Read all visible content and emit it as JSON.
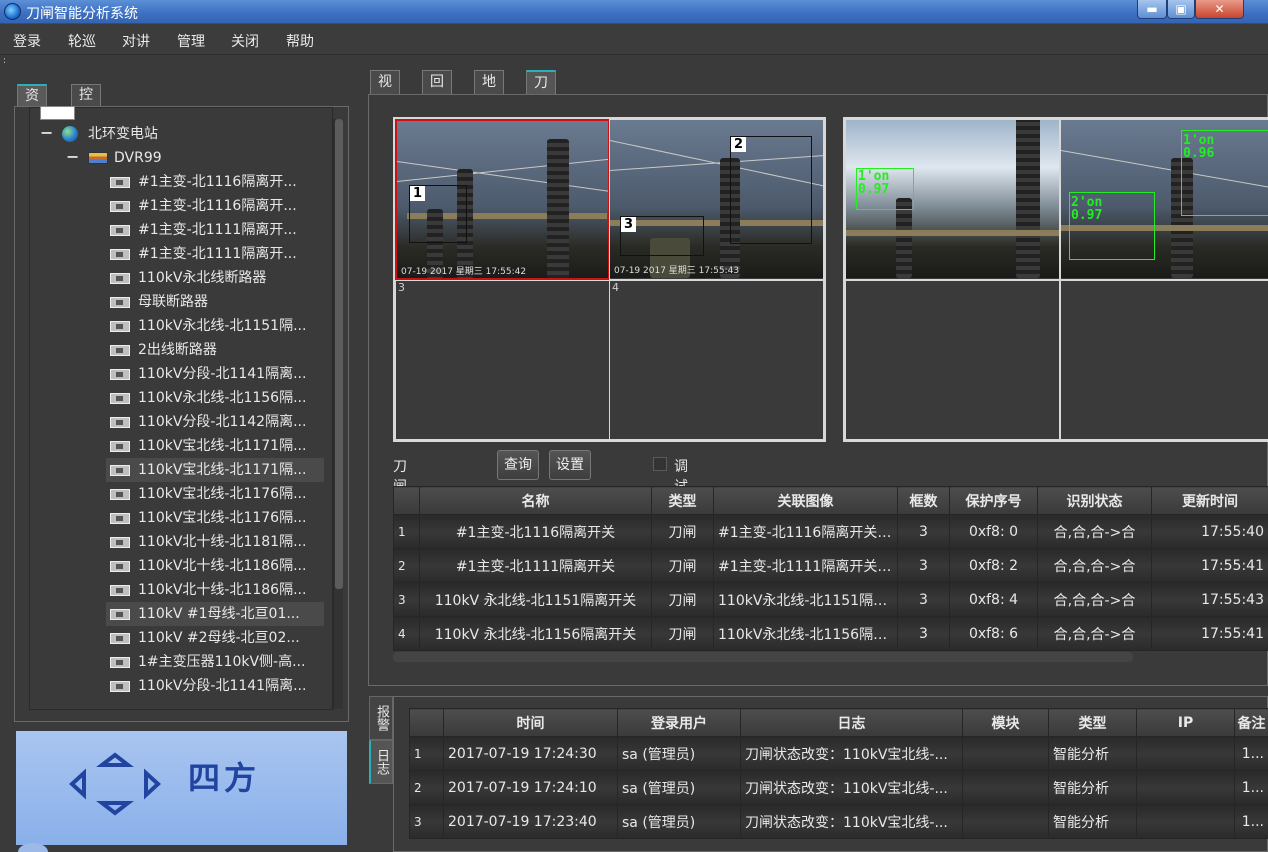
{
  "window": {
    "title": "刀闸智能分析系统",
    "min_label": "▬",
    "max_label": "▣",
    "close_label": "✕"
  },
  "menu": [
    "登录",
    "轮巡",
    "对讲",
    "管理",
    "关闭",
    "帮助"
  ],
  "left_tabs": [
    "资源",
    "控制"
  ],
  "tree": {
    "root": "北环变电站",
    "dvr": "DVR99",
    "items": [
      "#1主变-北1116隔离开...",
      "#1主变-北1116隔离开...",
      "#1主变-北1111隔离开...",
      "#1主变-北1111隔离开...",
      "110kV永北线断路器",
      "母联断路器",
      "110kV永北线-北1151隔...",
      "2出线断路器",
      "110kV分段-北1141隔离...",
      "110kV永北线-北1156隔...",
      "110kV分段-北1142隔离...",
      "110kV宝北线-北1171隔...",
      "110kV宝北线-北1171隔...",
      "110kV宝北线-北1176隔...",
      "110kV宝北线-北1176隔...",
      "110kV北十线-北1181隔...",
      "110kV北十线-北1186隔...",
      "110kV北十线-北1186隔...",
      "110kV #1母线-北亘01...",
      "110kV #2母线-北亘02...",
      "1#主变压器110kV侧-高...",
      "110kV分段-北1141隔离..."
    ]
  },
  "logo_text": "四方",
  "right_tabs": [
    "视频",
    "回放",
    "地图",
    "刀闸"
  ],
  "video": {
    "left_cell_numbers": [
      "3",
      "4"
    ],
    "box_labels": [
      "1",
      "2",
      "3"
    ],
    "left_timestamp": "07-19 2017 星期三 17:55:42",
    "right_timestamp": "07-19 2017 星期三 17:55:43",
    "right_cam1_label": "1'on\n0.97",
    "right_cam2_label_a": "1'on\n0.96",
    "right_cam2_label_b": "2'on\n0.97"
  },
  "toolbar": {
    "section_label": "刀闸",
    "query_btn": "查询",
    "settings_btn": "设置",
    "debug_mode": "调试模式"
  },
  "knife_table": {
    "headers": [
      "",
      "名称",
      "类型",
      "关联图像",
      "框数",
      "保护序号",
      "识别状态",
      "更新时间"
    ],
    "rows": [
      [
        "1",
        "#1主变-北1116隔离开关",
        "刀闸",
        "#1主变-北1116隔离开关…",
        "3",
        "0xf8: 0",
        "合,合,合->合",
        "17:55:40"
      ],
      [
        "2",
        "#1主变-北1111隔离开关",
        "刀闸",
        "#1主变-北1111隔离开关…",
        "3",
        "0xf8: 2",
        "合,合,合->合",
        "17:55:41"
      ],
      [
        "3",
        "110kV 永北线-北1151隔离开关",
        "刀闸",
        "110kV永北线-北1151隔…",
        "3",
        "0xf8: 4",
        "合,合,合->合",
        "17:55:43"
      ],
      [
        "4",
        "110kV 永北线-北1156隔离开关",
        "刀闸",
        "110kV永北线-北1156隔…",
        "3",
        "0xf8: 6",
        "合,合,合->合",
        "17:55:41"
      ]
    ]
  },
  "side_tabs": [
    "报警",
    "日志"
  ],
  "log_table": {
    "headers": [
      "",
      "时间",
      "登录用户",
      "日志",
      "模块",
      "类型",
      "IP",
      "备注"
    ],
    "rows": [
      [
        "1",
        "2017-07-19 17:24:30",
        "sa (管理员)",
        "刀闸状态改变：110kV宝北线-...",
        "",
        "智能分析",
        "",
        "1..."
      ],
      [
        "2",
        "2017-07-19 17:24:10",
        "sa (管理员)",
        "刀闸状态改变：110kV宝北线-...",
        "",
        "智能分析",
        "",
        "1..."
      ],
      [
        "3",
        "2017-07-19 17:23:40",
        "sa (管理员)",
        "刀闸状态改变：110kV宝北线-...",
        "",
        "智能分析",
        "",
        "1..."
      ]
    ]
  }
}
